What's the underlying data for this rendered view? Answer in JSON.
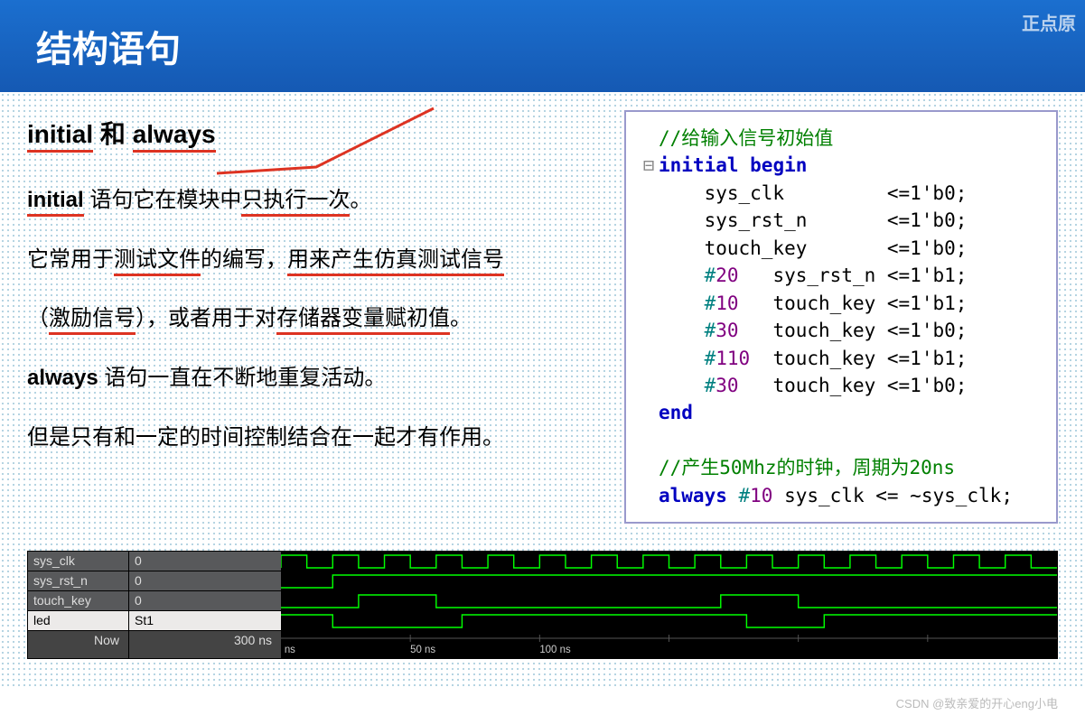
{
  "header": {
    "title": "结构语句",
    "corner": "正点原"
  },
  "section": {
    "subtitle_parts": [
      "initial",
      " 和 ",
      "always"
    ],
    "p1": {
      "a": "initial",
      "b": " 语句它在模块中",
      "c": "只执行一次",
      "d": "。"
    },
    "p2": {
      "a": "它常用于",
      "b": "测试文件",
      "c": "的编写，",
      "d": "用来产生仿真测试信号"
    },
    "p3": {
      "a": "（",
      "b": "激励信号",
      "c": "），或者用于对",
      "d": "存储器变量赋初值",
      "e": "。"
    },
    "p4": {
      "a": "always",
      "b": " 语句一直在不断地重复活动。"
    },
    "p5": "但是只有和一定的时间控制结合在一起才有作用。"
  },
  "code": {
    "c0": "//给输入信号初始值",
    "c1a": "initial",
    "c1b": " begin",
    "l1": "    sys_clk         <=1'b0;",
    "l2": "    sys_rst_n       <=1'b0;",
    "l3": "    touch_key       <=1'b0;",
    "d1": "20",
    "d1s": "   sys_rst_n <=1'b1;",
    "d2": "10",
    "d2s": "   touch_key <=1'b1;",
    "d3": "30",
    "d3s": "   touch_key <=1'b0;",
    "d4": "110",
    "d4s": "  touch_key <=1'b1;",
    "d5": "30",
    "d5s": "   touch_key <=1'b0;",
    "end": "end",
    "c2": "//产生50Mhz的时钟，周期为20ns",
    "aw": "always",
    "aw2": " #",
    "aw3": "10",
    "aw4": " sys_clk <= ~sys_clk;"
  },
  "wave": {
    "signals": [
      {
        "name": "sys_clk",
        "val": "0"
      },
      {
        "name": "sys_rst_n",
        "val": "0"
      },
      {
        "name": "touch_key",
        "val": "0"
      },
      {
        "name": "led",
        "val": "St1"
      }
    ],
    "now_label": "Now",
    "now_val": "300 ns",
    "ticks": [
      "ns",
      "50 ns",
      "100 ns"
    ]
  },
  "wm": "CSDN @致亲爱的开心eng小电"
}
